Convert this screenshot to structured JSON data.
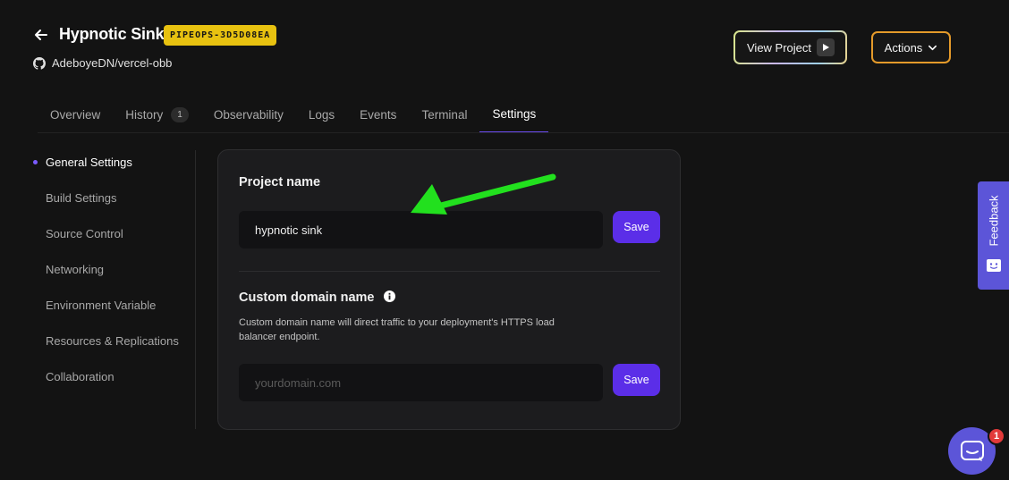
{
  "header": {
    "title": "Hypnotic Sink",
    "project_id": "PIPEOPS-3D5D08EA",
    "repo": "AdeboyeDN/vercel-obb",
    "view_project_label": "View Project",
    "actions_label": "Actions"
  },
  "tabs": [
    {
      "label": "Overview"
    },
    {
      "label": "History",
      "count": "1"
    },
    {
      "label": "Observability"
    },
    {
      "label": "Logs"
    },
    {
      "label": "Events"
    },
    {
      "label": "Terminal"
    },
    {
      "label": "Settings",
      "active": true
    }
  ],
  "sidebar": {
    "items": [
      {
        "label": "General Settings",
        "active": true
      },
      {
        "label": "Build Settings"
      },
      {
        "label": "Source Control"
      },
      {
        "label": "Networking"
      },
      {
        "label": "Environment Variable"
      },
      {
        "label": "Resources & Replications"
      },
      {
        "label": "Collaboration"
      }
    ]
  },
  "project_name": {
    "title": "Project name",
    "value": "hypnotic sink",
    "save_label": "Save"
  },
  "custom_domain": {
    "title": "Custom domain name",
    "description": "Custom domain name will direct traffic to your deployment's HTTPS load balancer endpoint.",
    "placeholder": "yourdomain.com",
    "value": "",
    "save_label": "Save"
  },
  "feedback": {
    "label": "Feedback"
  },
  "chat": {
    "badge_count": "1"
  },
  "colors": {
    "accent": "#5b2ee8",
    "badge": "#e8c210",
    "actions_border": "#e49a2a",
    "annotation_arrow": "#22e01e",
    "feedback_bg": "#5c55d8"
  },
  "icons": {
    "back": "arrow-left-icon",
    "repo": "github-icon",
    "view_project": "play-icon",
    "actions": "chevron-down-icon",
    "info": "info-icon",
    "feedback": "feedback-icon",
    "chat": "chat-icon"
  }
}
